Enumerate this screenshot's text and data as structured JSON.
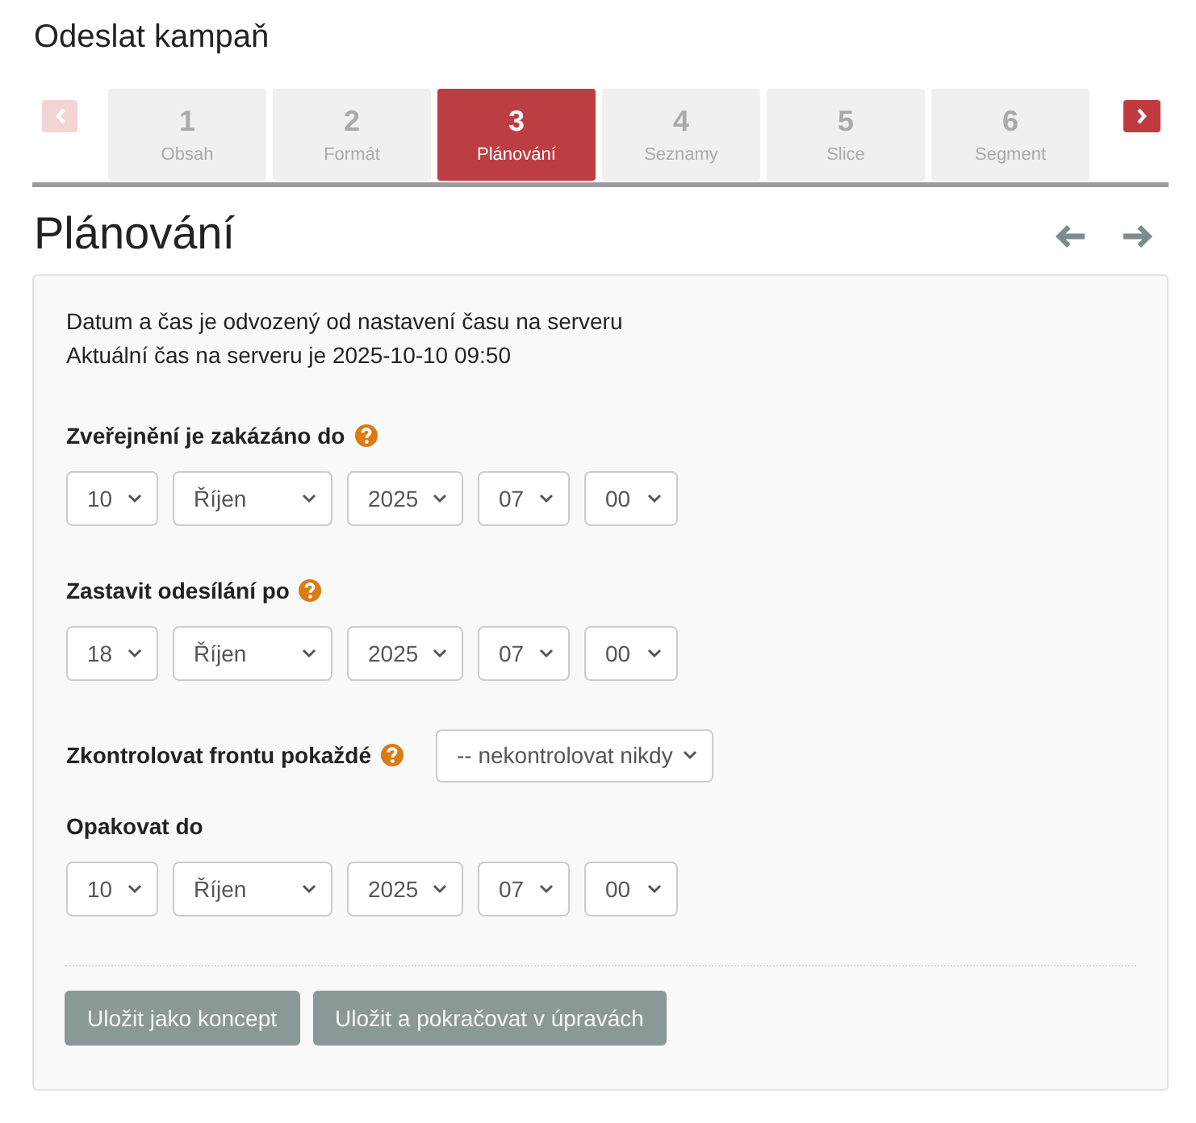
{
  "page": {
    "title": "Odeslat kampaň"
  },
  "wizard": {
    "prev_button": {
      "disabled": true
    },
    "next_button": {
      "disabled": false
    },
    "steps": [
      {
        "number": "1",
        "label": "Obsah",
        "selected": false
      },
      {
        "number": "2",
        "label": "Formát",
        "selected": false
      },
      {
        "number": "3",
        "label": "Plánování",
        "selected": true
      },
      {
        "number": "4",
        "label": "Seznamy",
        "selected": false
      },
      {
        "number": "5",
        "label": "Slice",
        "selected": false
      },
      {
        "number": "6",
        "label": "Segment",
        "selected": false
      }
    ]
  },
  "section": {
    "heading": "Plánování"
  },
  "panel": {
    "info_lines": [
      "Datum a čas je odvozený od nastavení času na serveru",
      "Aktuální čas na serveru je 2025-10-10 09:50"
    ],
    "fields": [
      {
        "kind": "datetime",
        "label": "Zveřejnění je zakázáno do",
        "help": true,
        "selects": [
          "10",
          "Říjen",
          "2025",
          "07",
          "00"
        ]
      },
      {
        "kind": "datetime",
        "label": "Zastavit odesílání po",
        "help": true,
        "selects": [
          "18",
          "Říjen",
          "2025",
          "07",
          "00"
        ]
      },
      {
        "kind": "select",
        "label": "Zkontrolovat frontu pokaždé",
        "help": true,
        "value": "-- nekontrolovat nikdy"
      },
      {
        "kind": "datetime",
        "label": "Opakovat do",
        "help": false,
        "selects": [
          "10",
          "Říjen",
          "2025",
          "07",
          "00"
        ]
      }
    ],
    "buttons": [
      "Uložit jako koncept",
      "Uložit a pokračovat v úpravách"
    ]
  }
}
